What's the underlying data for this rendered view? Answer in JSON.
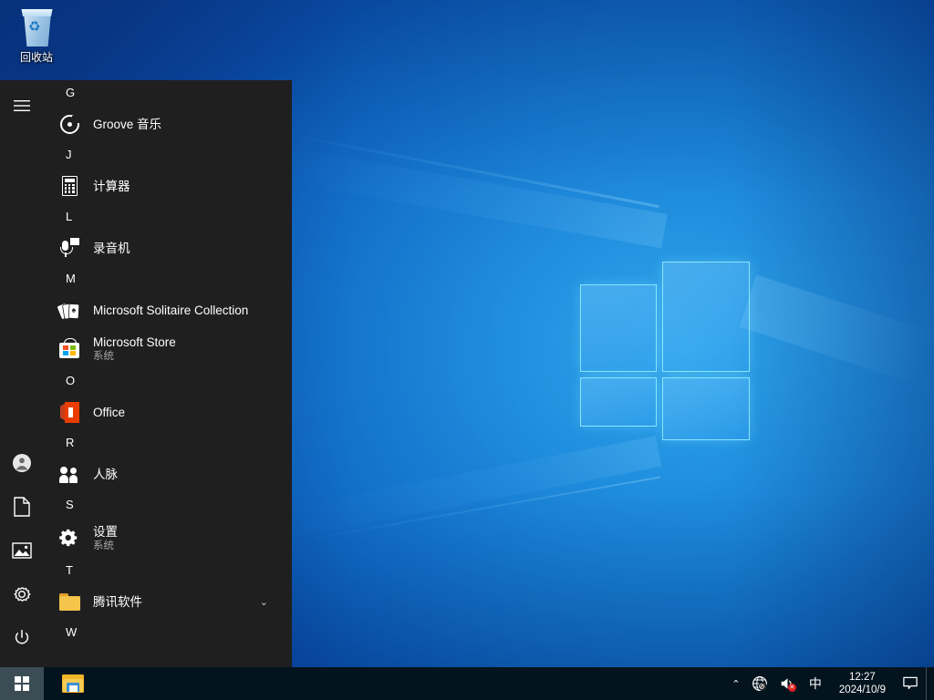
{
  "desktop": {
    "icons": [
      {
        "name": "recycle-bin",
        "label": "回收站",
        "icon": "recycle-bin-icon"
      }
    ],
    "wallpaper": {
      "name": "windows-10-hero",
      "accent": "#0a78d4"
    }
  },
  "start_menu": {
    "rail": {
      "top": [
        {
          "name": "hamburger",
          "icon": "hamburger-icon",
          "label": "展开"
        }
      ],
      "bottom": [
        {
          "name": "account",
          "icon": "user-account-icon",
          "label": "用户"
        },
        {
          "name": "documents",
          "icon": "document-icon",
          "label": "文档"
        },
        {
          "name": "pictures",
          "icon": "picture-icon",
          "label": "图片"
        },
        {
          "name": "settings",
          "icon": "gear-icon",
          "label": "设置"
        },
        {
          "name": "power",
          "icon": "power-icon",
          "label": "电源"
        }
      ]
    },
    "groups": [
      {
        "letter": "G",
        "apps": [
          {
            "name": "Groove 音乐",
            "sub": "",
            "icon": "groove-music-icon",
            "chevron": false
          }
        ]
      },
      {
        "letter": "J",
        "apps": [
          {
            "name": "计算器",
            "sub": "",
            "icon": "calculator-icon",
            "chevron": false
          }
        ]
      },
      {
        "letter": "L",
        "apps": [
          {
            "name": "录音机",
            "sub": "",
            "icon": "voice-recorder-icon",
            "chevron": false
          }
        ]
      },
      {
        "letter": "M",
        "apps": [
          {
            "name": "Microsoft Solitaire Collection",
            "sub": "",
            "icon": "solitaire-cards-icon",
            "chevron": false
          },
          {
            "name": "Microsoft Store",
            "sub": "系统",
            "icon": "microsoft-store-icon",
            "chevron": false
          }
        ]
      },
      {
        "letter": "O",
        "apps": [
          {
            "name": "Office",
            "sub": "",
            "icon": "office-icon",
            "chevron": false
          }
        ]
      },
      {
        "letter": "R",
        "apps": [
          {
            "name": "人脉",
            "sub": "",
            "icon": "people-icon",
            "chevron": false
          }
        ]
      },
      {
        "letter": "S",
        "apps": [
          {
            "name": "设置",
            "sub": "系统",
            "icon": "gear-icon",
            "chevron": false
          }
        ]
      },
      {
        "letter": "T",
        "apps": [
          {
            "name": "腾讯软件",
            "sub": "",
            "icon": "folder-icon",
            "chevron": true,
            "chevron_glyph": "⌄"
          }
        ]
      },
      {
        "letter": "W",
        "apps": []
      }
    ]
  },
  "taskbar": {
    "start_button": {
      "name": "start-button",
      "icon": "windows-logo-icon",
      "label": "开始"
    },
    "apps": [
      {
        "name": "file-explorer",
        "icon": "file-explorer-icon",
        "label": "文件资源管理器"
      }
    ],
    "tray": {
      "chevron": "⌃",
      "network": {
        "icon": "network-globe-icon",
        "label": "网络 - 无 Internet 访问"
      },
      "volume": {
        "icon": "speaker-muted-icon",
        "label": "扬声器：已静音",
        "badge": "✕"
      },
      "ime": {
        "icon": "ime-icon",
        "label": "中"
      },
      "clock": {
        "time": "12:27",
        "date": "2024/10/9"
      },
      "action_center": {
        "icon": "action-center-icon",
        "label": "通知"
      },
      "show_desktop": {
        "label": "显示桌面"
      }
    }
  }
}
